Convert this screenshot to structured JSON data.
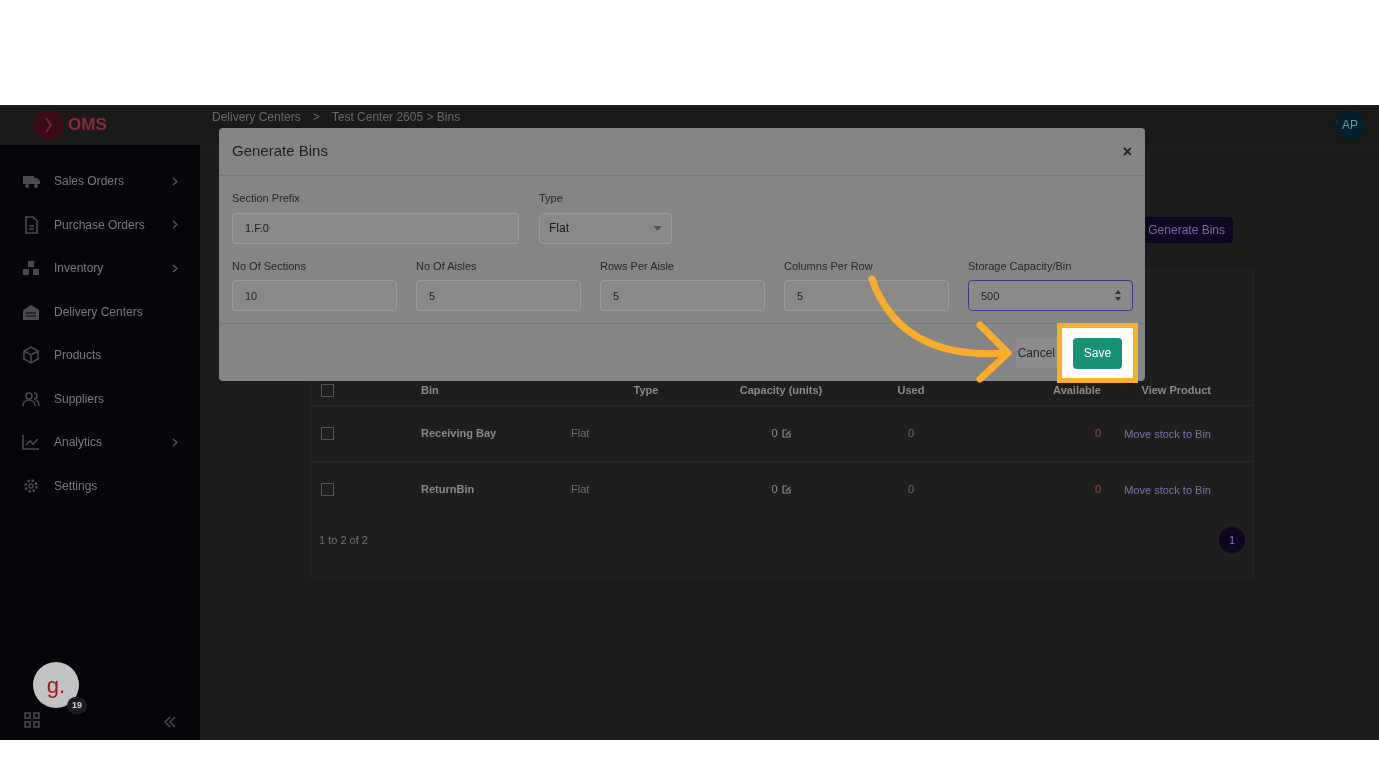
{
  "header": {
    "logo": "OMS",
    "breadcrumb": [
      "Delivery Centers",
      ">",
      "Test Center 2605 > Bins"
    ],
    "avatar": "AP"
  },
  "sidebar": {
    "items": [
      {
        "label": "Sales Orders",
        "has_submenu": true
      },
      {
        "label": "Purchase Orders",
        "has_submenu": true
      },
      {
        "label": "Inventory",
        "has_submenu": true
      },
      {
        "label": "Delivery Centers",
        "has_submenu": false
      },
      {
        "label": "Products",
        "has_submenu": false
      },
      {
        "label": "Suppliers",
        "has_submenu": false
      },
      {
        "label": "Analytics",
        "has_submenu": true
      },
      {
        "label": "Settings",
        "has_submenu": false
      }
    ],
    "widget": {
      "letter": "g.",
      "badge": "19"
    }
  },
  "page": {
    "generate_button": "Generate Bins",
    "table": {
      "all_checked": false,
      "columns": [
        "Bin",
        "Type",
        "Capacity (units)",
        "Used",
        "Available",
        "View Product"
      ],
      "rows": [
        {
          "checked": false,
          "bin": "Receiving Bay",
          "type": "Flat",
          "capacity": "0",
          "used": "0",
          "available": "0",
          "action": "Move stock to Bin"
        },
        {
          "checked": false,
          "bin": "ReturnBin",
          "type": "Flat",
          "capacity": "0",
          "used": "0",
          "available": "0",
          "action": "Move stock to Bin"
        }
      ],
      "footer": "1 to 2 of 2",
      "page": "1"
    }
  },
  "modal": {
    "title": "Generate Bins",
    "close": "×",
    "section_prefix": {
      "label": "Section Prefix",
      "value": "1.F.0"
    },
    "type": {
      "label": "Type",
      "value": "Flat"
    },
    "fields": [
      {
        "label": "No Of Sections",
        "value": "10",
        "focused": false
      },
      {
        "label": "No Of Aisles",
        "value": "5",
        "focused": false
      },
      {
        "label": "Rows Per Aisle",
        "value": "5",
        "focused": false
      },
      {
        "label": "Columns Per Row",
        "value": "5",
        "focused": false
      },
      {
        "label": "Storage Capacity/Bin",
        "value": "500",
        "focused": true
      }
    ],
    "cancel": "Cancel",
    "save": "Save"
  }
}
